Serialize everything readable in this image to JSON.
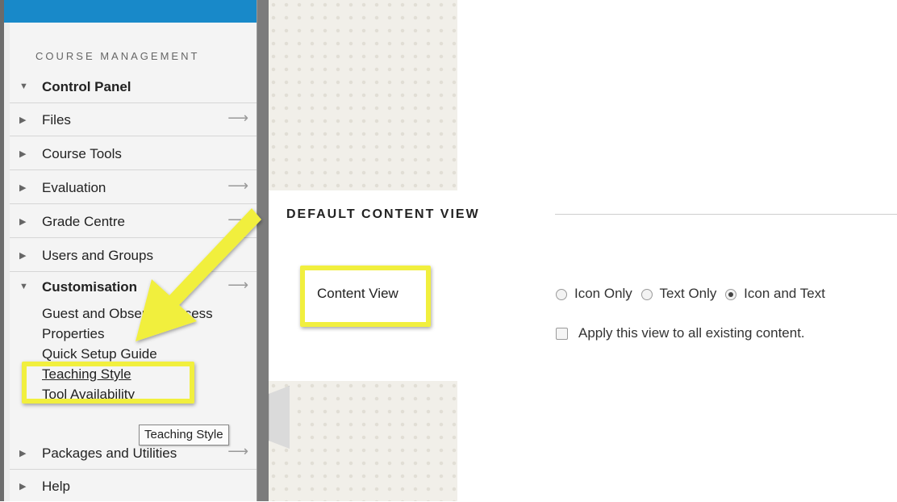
{
  "sidebar": {
    "section_heading": "COURSE MANAGEMENT",
    "control_panel": "Control Panel",
    "items": [
      {
        "label": "Files"
      },
      {
        "label": "Course Tools"
      },
      {
        "label": "Evaluation"
      },
      {
        "label": "Grade Centre"
      },
      {
        "label": "Users and Groups"
      },
      {
        "label": "Customisation"
      },
      {
        "label": "Packages and Utilities"
      },
      {
        "label": "Help"
      }
    ],
    "customisation_links": [
      "Guest and Observer Access",
      "Properties",
      "Quick Setup Guide",
      "Teaching Style",
      "Tool Availability"
    ],
    "tooltip": "Teaching Style"
  },
  "content": {
    "section_title": "DEFAULT CONTENT VIEW",
    "field_label": "Content View",
    "options": [
      "Icon Only",
      "Text Only",
      "Icon and Text"
    ],
    "selected_option": "Icon and Text",
    "checkbox_label": "Apply this view to all existing content."
  },
  "colors": {
    "highlight": "#f1ef3e",
    "topbar": "#1889c9"
  },
  "icons": {
    "expand": "triangle-right-icon",
    "collapse": "triangle-down-icon",
    "go": "arrow-right-icon"
  }
}
